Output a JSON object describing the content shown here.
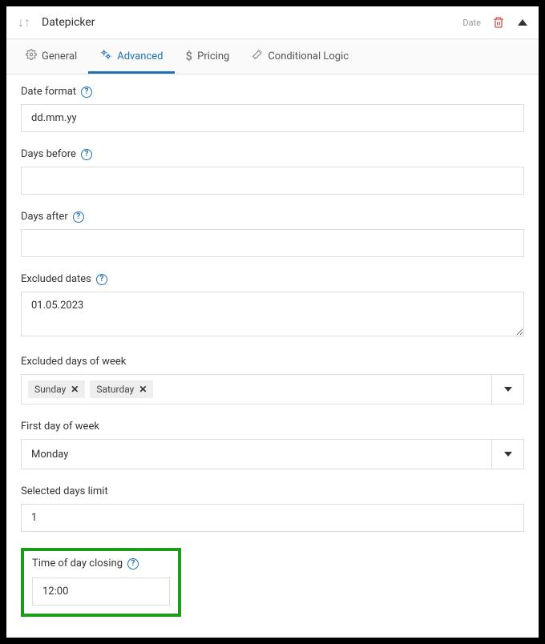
{
  "header": {
    "title": "Datepicker",
    "type_label": "Date"
  },
  "tabs": {
    "general": "General",
    "advanced": "Advanced",
    "pricing": "Pricing",
    "conditional": "Conditional Logic"
  },
  "fields": {
    "date_format": {
      "label": "Date format",
      "value": "dd.mm.yy"
    },
    "days_before": {
      "label": "Days before",
      "value": ""
    },
    "days_after": {
      "label": "Days after",
      "value": ""
    },
    "excluded_dates": {
      "label": "Excluded dates",
      "value": "01.05.2023"
    },
    "excluded_days": {
      "label": "Excluded days of week",
      "tags": [
        "Sunday",
        "Saturday"
      ]
    },
    "first_day": {
      "label": "First day of week",
      "value": "Monday"
    },
    "selected_limit": {
      "label": "Selected days limit",
      "value": "1"
    },
    "time_closing": {
      "label": "Time of day closing",
      "value": "12:00"
    }
  }
}
